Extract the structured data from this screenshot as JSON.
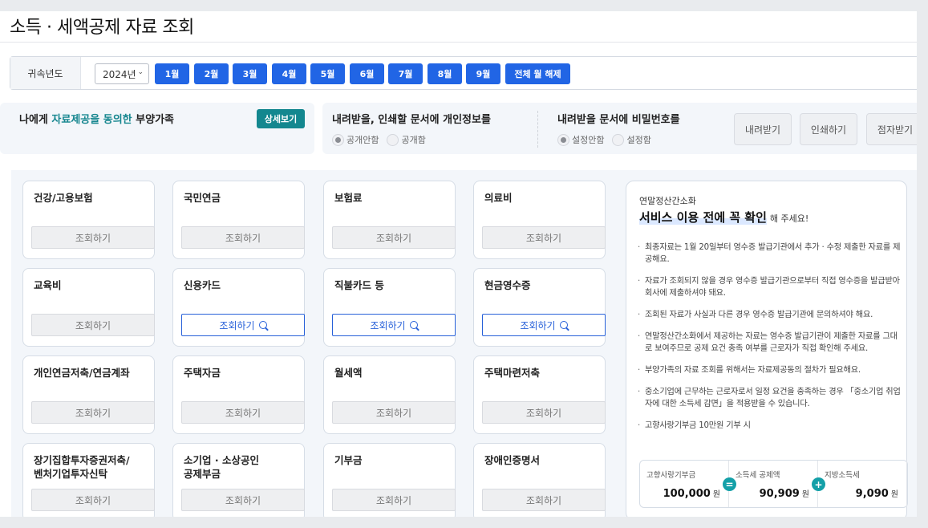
{
  "page": {
    "title": "소득 · 세액공제 자료 조회"
  },
  "year_bar": {
    "label": "귀속년도",
    "selected_year": "2024년",
    "months": [
      "1월",
      "2월",
      "3월",
      "4월",
      "5월",
      "6월",
      "7월",
      "8월",
      "9월"
    ],
    "clear_label": "전체 월 해제"
  },
  "consent": {
    "text_prefix": "나에게 ",
    "text_highlight": "자료제공을 동의한",
    "text_suffix": " 부양가족",
    "detail_button": "상세보기"
  },
  "privacy": {
    "group1": {
      "heading": "내려받을, 인쇄할 문서에 개인정보를",
      "options": [
        "공개안함",
        "공개함"
      ],
      "selected": 0
    },
    "group2": {
      "heading": "내려받을 문서에 비밀번호를",
      "options": [
        "설정안함",
        "설정함"
      ],
      "selected": 0
    },
    "buttons": [
      "내려받기",
      "인쇄하기",
      "점자받기"
    ]
  },
  "cards": [
    {
      "name": "건강/고용보험",
      "button": "조회하기",
      "active": false
    },
    {
      "name": "국민연금",
      "button": "조회하기",
      "active": false
    },
    {
      "name": "보험료",
      "button": "조회하기",
      "active": false
    },
    {
      "name": "의료비",
      "button": "조회하기",
      "active": false
    },
    {
      "name": "교육비",
      "button": "조회하기",
      "active": false
    },
    {
      "name": "신용카드",
      "button": "조회하기",
      "active": true
    },
    {
      "name": "직불카드 등",
      "button": "조회하기",
      "active": true
    },
    {
      "name": "현금영수증",
      "button": "조회하기",
      "active": true
    },
    {
      "name": "개인연금저축/연금계좌",
      "button": "조회하기",
      "active": false
    },
    {
      "name": "주택자금",
      "button": "조회하기",
      "active": false
    },
    {
      "name": "월세액",
      "button": "조회하기",
      "active": false
    },
    {
      "name": "주택마련저축",
      "button": "조회하기",
      "active": false
    },
    {
      "name": "장기집합투자증권저축/\n벤처기업투자신탁",
      "button": "조회하기",
      "active": false
    },
    {
      "name": "소기업 · 소상공인\n공제부금",
      "button": "조회하기",
      "active": false
    },
    {
      "name": "기부금",
      "button": "조회하기",
      "active": false
    },
    {
      "name": "장애인증명서",
      "button": "조회하기",
      "active": false
    }
  ],
  "notice": {
    "subtitle": "연말정산간소화",
    "heading": "서비스 이용 전에 꼭 확인",
    "heading_tail": "해 주세요!",
    "items": [
      "최종자료는 1월 20일부터 영수증 발급기관에서 추가 · 수정 제출한 자료를 제공해요.",
      "자료가 조회되지 않을 경우 영수증 발급기관으로부터 직접 영수증을 발급받아 회사에 제출하셔야 돼요.",
      "조회된 자료가 사실과 다른 경우 영수증 발급기관에 문의하셔야 해요.",
      "연말정산간소화에서 제공하는 자료는 영수증 발급기관이 제출한 자료를 그대로 보여주므로 공제 요건 충족 여부를 근로자가 직접 확인해 주세요.",
      "부양가족의 자료 조회를 위해서는 자료제공동의 절차가 필요해요.",
      "중소기업에 근무하는 근로자로서 일정 요건을 충족하는 경우 「중소기업 취업자에 대한 소득세 감면」을 적용받을 수 있습니다.",
      "고향사랑기부금 10만원 기부 시"
    ],
    "calc": {
      "col1_label": "고향사랑기부금",
      "col1_value": "100,000",
      "col2_label": "소득세 공제액",
      "col2_value": "90,909",
      "col3_label": "지방소득세",
      "col3_value": "9,090",
      "unit": "원",
      "op1": "=",
      "op2": "+"
    }
  }
}
